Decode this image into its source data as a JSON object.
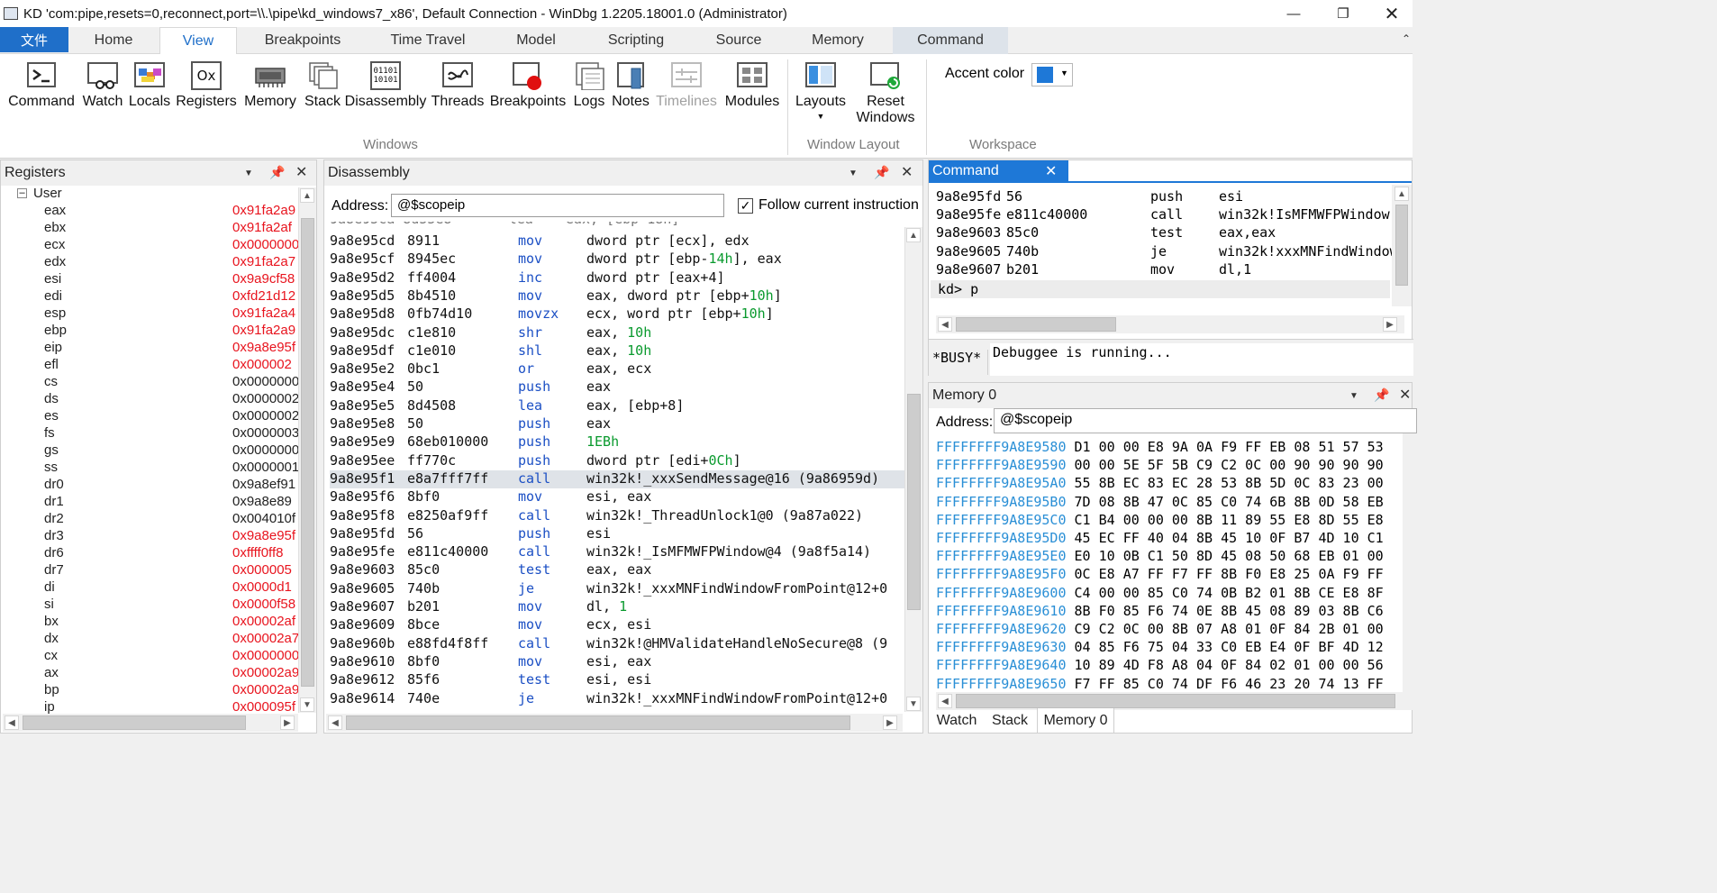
{
  "window": {
    "title": "KD 'com:pipe,resets=0,reconnect,port=\\\\.\\pipe\\kd_windows7_x86', Default Connection  - WinDbg 1.2205.18001.0 (Administrator)"
  },
  "menu": {
    "file": "文件",
    "tabs": [
      "Home",
      "View",
      "Breakpoints",
      "Time Travel",
      "Model",
      "Scripting",
      "Source",
      "Memory",
      "Command"
    ],
    "active": "View"
  },
  "ribbon": {
    "windows": [
      "Command",
      "Watch",
      "Locals",
      "Registers",
      "Memory",
      "Stack",
      "Disassembly",
      "Threads",
      "Breakpoints",
      "Logs",
      "Notes",
      "Timelines",
      "Modules"
    ],
    "disabled": [
      "Timelines"
    ],
    "layouts": "Layouts",
    "reset_line1": "Reset",
    "reset_line2": "Windows",
    "accent_label": "Accent color",
    "accent_color": "#1e78d7",
    "groups": {
      "windows": "Windows",
      "layout": "Window Layout",
      "workspace": "Workspace"
    },
    "icon_text": {
      "registers": "Ox",
      "disassembly": "01101\n10101"
    }
  },
  "registers": {
    "title": "Registers",
    "group": "User",
    "rows": [
      {
        "n": "eax",
        "v": "0x91fa2a9",
        "c": "red"
      },
      {
        "n": "ebx",
        "v": "0x91fa2af",
        "c": "red"
      },
      {
        "n": "ecx",
        "v": "0x0000000",
        "c": "red"
      },
      {
        "n": "edx",
        "v": "0x91fa2a7",
        "c": "red"
      },
      {
        "n": "esi",
        "v": "0x9a9cf58",
        "c": "red"
      },
      {
        "n": "edi",
        "v": "0xfd21d12",
        "c": "red"
      },
      {
        "n": "esp",
        "v": "0x91fa2a4",
        "c": "red"
      },
      {
        "n": "ebp",
        "v": "0x91fa2a9",
        "c": "red"
      },
      {
        "n": "eip",
        "v": "0x9a8e95f",
        "c": "red"
      },
      {
        "n": "efl",
        "v": "0x000002",
        "c": "red"
      },
      {
        "n": "cs",
        "v": "0x0000000",
        "c": "black"
      },
      {
        "n": "ds",
        "v": "0x0000002",
        "c": "black"
      },
      {
        "n": "es",
        "v": "0x0000002",
        "c": "black"
      },
      {
        "n": "fs",
        "v": "0x0000003",
        "c": "black"
      },
      {
        "n": "gs",
        "v": "0x0000000",
        "c": "black"
      },
      {
        "n": "ss",
        "v": "0x0000001",
        "c": "black"
      },
      {
        "n": "dr0",
        "v": "0x9a8ef91",
        "c": "black"
      },
      {
        "n": "dr1",
        "v": "0x9a8e89",
        "c": "black"
      },
      {
        "n": "dr2",
        "v": "0x004010f",
        "c": "black"
      },
      {
        "n": "dr3",
        "v": "0x9a8e95f",
        "c": "red"
      },
      {
        "n": "dr6",
        "v": "0xffff0ff8",
        "c": "red"
      },
      {
        "n": "dr7",
        "v": "0x000005",
        "c": "red"
      },
      {
        "n": "di",
        "v": "0x0000d1",
        "c": "red"
      },
      {
        "n": "si",
        "v": "0x0000f58",
        "c": "red"
      },
      {
        "n": "bx",
        "v": "0x00002af",
        "c": "red"
      },
      {
        "n": "dx",
        "v": "0x00002a7",
        "c": "red"
      },
      {
        "n": "cx",
        "v": "0x0000000",
        "c": "red"
      },
      {
        "n": "ax",
        "v": "0x00002a9",
        "c": "red"
      },
      {
        "n": "bp",
        "v": "0x00002a9",
        "c": "red"
      },
      {
        "n": "ip",
        "v": "0x000095f",
        "c": "red"
      }
    ]
  },
  "disassembly": {
    "title": "Disassembly",
    "address_label": "Address:",
    "address_value": "@$scopeip",
    "follow_label": "Follow current instruction",
    "rows": [
      [
        "9a8e95cd",
        "8911",
        "mov",
        "dword ptr [ecx], edx"
      ],
      [
        "9a8e95cf",
        "8945ec",
        "mov",
        "dword ptr [ebp-14h], eax"
      ],
      [
        "9a8e95d2",
        "ff4004",
        "inc",
        "dword ptr [eax+4]"
      ],
      [
        "9a8e95d5",
        "8b4510",
        "mov",
        "eax, dword ptr [ebp+10h]"
      ],
      [
        "9a8e95d8",
        "0fb74d10",
        "movzx",
        "ecx, word ptr [ebp+10h]"
      ],
      [
        "9a8e95dc",
        "c1e810",
        "shr",
        "eax, 10h"
      ],
      [
        "9a8e95df",
        "c1e010",
        "shl",
        "eax, 10h"
      ],
      [
        "9a8e95e2",
        "0bc1",
        "or",
        "eax, ecx"
      ],
      [
        "9a8e95e4",
        "50",
        "push",
        "eax"
      ],
      [
        "9a8e95e5",
        "8d4508",
        "lea",
        "eax, [ebp+8]"
      ],
      [
        "9a8e95e8",
        "50",
        "push",
        "eax"
      ],
      [
        "9a8e95e9",
        "68eb010000",
        "push",
        "1EBh"
      ],
      [
        "9a8e95ee",
        "ff770c",
        "push",
        "dword ptr [edi+0Ch]"
      ],
      [
        "9a8e95f1",
        "e8a7fff7ff",
        "call",
        "win32k!_xxxSendMessage@16 (9a86959d)"
      ],
      [
        "9a8e95f6",
        "8bf0",
        "mov",
        "esi, eax"
      ],
      [
        "9a8e95f8",
        "e8250af9ff",
        "call",
        "win32k!_ThreadUnlock1@0 (9a87a022)"
      ],
      [
        "9a8e95fd",
        "56",
        "push",
        "esi"
      ],
      [
        "9a8e95fe",
        "e811c40000",
        "call",
        "win32k!_IsMFMWFPWindow@4 (9a8f5a14)"
      ],
      [
        "9a8e9603",
        "85c0",
        "test",
        "eax, eax"
      ],
      [
        "9a8e9605",
        "740b",
        "je",
        "win32k!_xxxMNFindWindowFromPoint@12+0"
      ],
      [
        "9a8e9607",
        "b201",
        "mov",
        "dl, 1"
      ],
      [
        "9a8e9609",
        "8bce",
        "mov",
        "ecx, esi"
      ],
      [
        "9a8e960b",
        "e88fd4f8ff",
        "call",
        "win32k!@HMValidateHandleNoSecure@8 (9"
      ],
      [
        "9a8e9610",
        "8bf0",
        "mov",
        "esi, eax"
      ],
      [
        "9a8e9612",
        "85f6",
        "test",
        "esi, esi"
      ],
      [
        "9a8e9614",
        "740e",
        "je",
        "win32k!_xxxMNFindWindowFromPoint@12+0"
      ]
    ],
    "highlight": "9a8e95f1"
  },
  "command": {
    "title": "Command",
    "rows": [
      [
        "9a8e95fd",
        "56",
        "push",
        "esi"
      ],
      [
        "9a8e95fe",
        "e811c40000",
        "call",
        "win32k!IsMFMWFPWindow"
      ],
      [
        "9a8e9603",
        "85c0",
        "test",
        "eax,eax"
      ],
      [
        "9a8e9605",
        "740b",
        "je",
        "win32k!xxxMNFindWindow"
      ],
      [
        "9a8e9607",
        "b201",
        "mov",
        "dl,1"
      ]
    ],
    "prompt": "kd> p",
    "busy": "*BUSY*",
    "status": "Debuggee is running..."
  },
  "memory": {
    "title": "Memory 0",
    "address_label": "Address:",
    "address_value": "@$scopeip",
    "rows": [
      [
        "FFFFFFFF9A8E9580",
        "D1 00 00 E8 9A 0A F9 FF EB 08 51 57 53"
      ],
      [
        "FFFFFFFF9A8E9590",
        "00 00 5E 5F 5B C9 C2 0C 00 90 90 90 90"
      ],
      [
        "FFFFFFFF9A8E95A0",
        "55 8B EC 83 EC 28 53 8B 5D 0C 83 23 00"
      ],
      [
        "FFFFFFFF9A8E95B0",
        "7D 08 8B 47 0C 85 C0 74 6B 8B 0D 58 EB"
      ],
      [
        "FFFFFFFF9A8E95C0",
        "C1 B4 00 00 00 8B 11 89 55 E8 8D 55 E8"
      ],
      [
        "FFFFFFFF9A8E95D0",
        "45 EC FF 40 04 8B 45 10 0F B7 4D 10 C1"
      ],
      [
        "FFFFFFFF9A8E95E0",
        "E0 10 0B C1 50 8D 45 08 50 68 EB 01 00"
      ],
      [
        "FFFFFFFF9A8E95F0",
        "0C E8 A7 FF F7 FF 8B F0 E8 25 0A F9 FF"
      ],
      [
        "FFFFFFFF9A8E9600",
        "C4 00 00 85 C0 74 0B B2 01 8B CE E8 8F"
      ],
      [
        "FFFFFFFF9A8E9610",
        "8B F0 85 F6 74 0E 8B 45 08 89 03 8B C6"
      ],
      [
        "FFFFFFFF9A8E9620",
        "C9 C2 0C 00 8B 07 A8 01 0F 84 2B 01 00"
      ],
      [
        "FFFFFFFF9A8E9630",
        "04 85 F6 75 04 33 C0 EB E4 0F BF 4D 12"
      ],
      [
        "FFFFFFFF9A8E9640",
        "10 89 4D F8 A8 04 0F 84 02 01 00 00 56"
      ],
      [
        "FFFFFFFF9A8E9650",
        "F7 FF 85 C0 74 DF F6 46 23 20 74 13 FF"
      ]
    ]
  },
  "bottom_tabs": [
    "Watch",
    "Stack",
    "Memory 0"
  ],
  "colors": {
    "accent": "#1f6fc9",
    "red": "#e8141e",
    "blue_mnemonic": "#1b4fc4",
    "green_imm": "#0a9a2e",
    "mem_addr": "#2a8fd6",
    "cmd_tab": "#1e78d7",
    "highlight_row": "#dfe3e8"
  }
}
